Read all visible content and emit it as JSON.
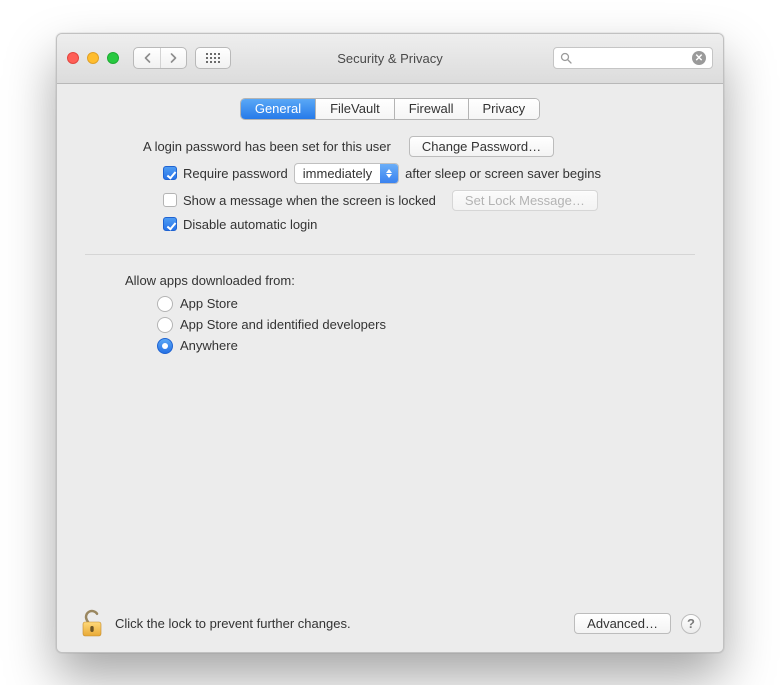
{
  "window": {
    "title": "Security & Privacy"
  },
  "tabs": [
    "General",
    "FileVault",
    "Firewall",
    "Privacy"
  ],
  "active_tab_index": 0,
  "general": {
    "login_password_text": "A login password has been set for this user",
    "change_password_btn": "Change Password…",
    "require_password": {
      "checked": true,
      "label_before": "Require password",
      "delay_value": "immediately",
      "label_after": "after sleep or screen saver begins"
    },
    "show_message": {
      "checked": false,
      "label": "Show a message when the screen is locked",
      "set_btn": "Set Lock Message…",
      "set_btn_enabled": false
    },
    "disable_auto_login": {
      "checked": true,
      "label": "Disable automatic login"
    },
    "allow_apps": {
      "title": "Allow apps downloaded from:",
      "options": [
        "App Store",
        "App Store and identified developers",
        "Anywhere"
      ],
      "selected_index": 2
    }
  },
  "footer": {
    "lock_text": "Click the lock to prevent further changes.",
    "advanced_btn": "Advanced…",
    "help_symbol": "?"
  }
}
